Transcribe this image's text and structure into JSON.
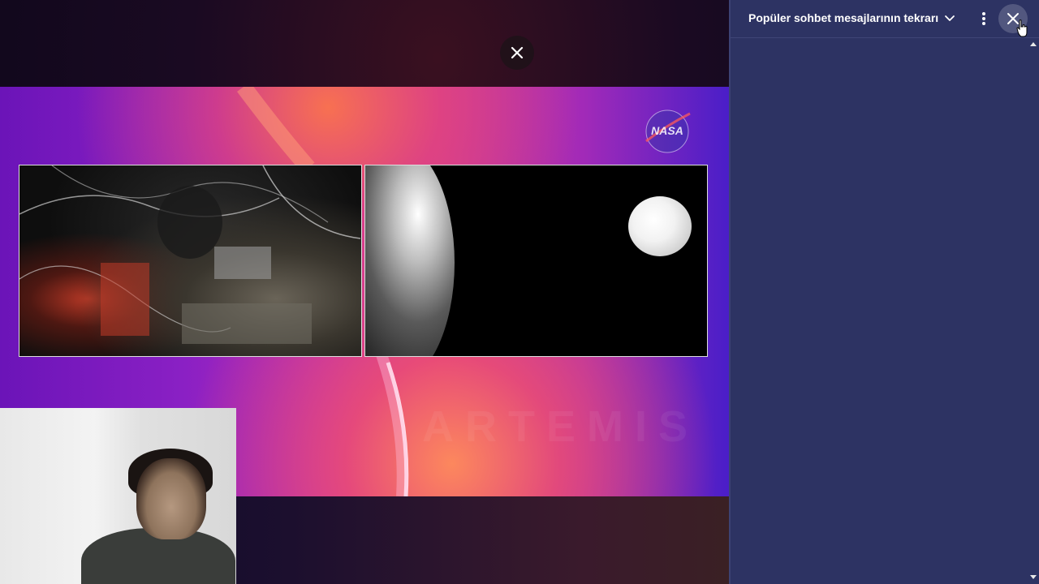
{
  "player": {
    "broadcaster_logo": "NASA",
    "overlay_close_icon": "close-icon",
    "watermark_text": "ARTEMIS"
  },
  "chat": {
    "title": "Popüler sohbet mesajlarının tekrarı",
    "dropdown_icon": "chevron-down-icon",
    "menu_icon": "more-vert-icon",
    "close_icon": "close-icon",
    "messages": []
  },
  "colors": {
    "chat_background": "#2d3363",
    "accent_magenta": "#b42ab8",
    "accent_orange": "#ff8c5a"
  }
}
